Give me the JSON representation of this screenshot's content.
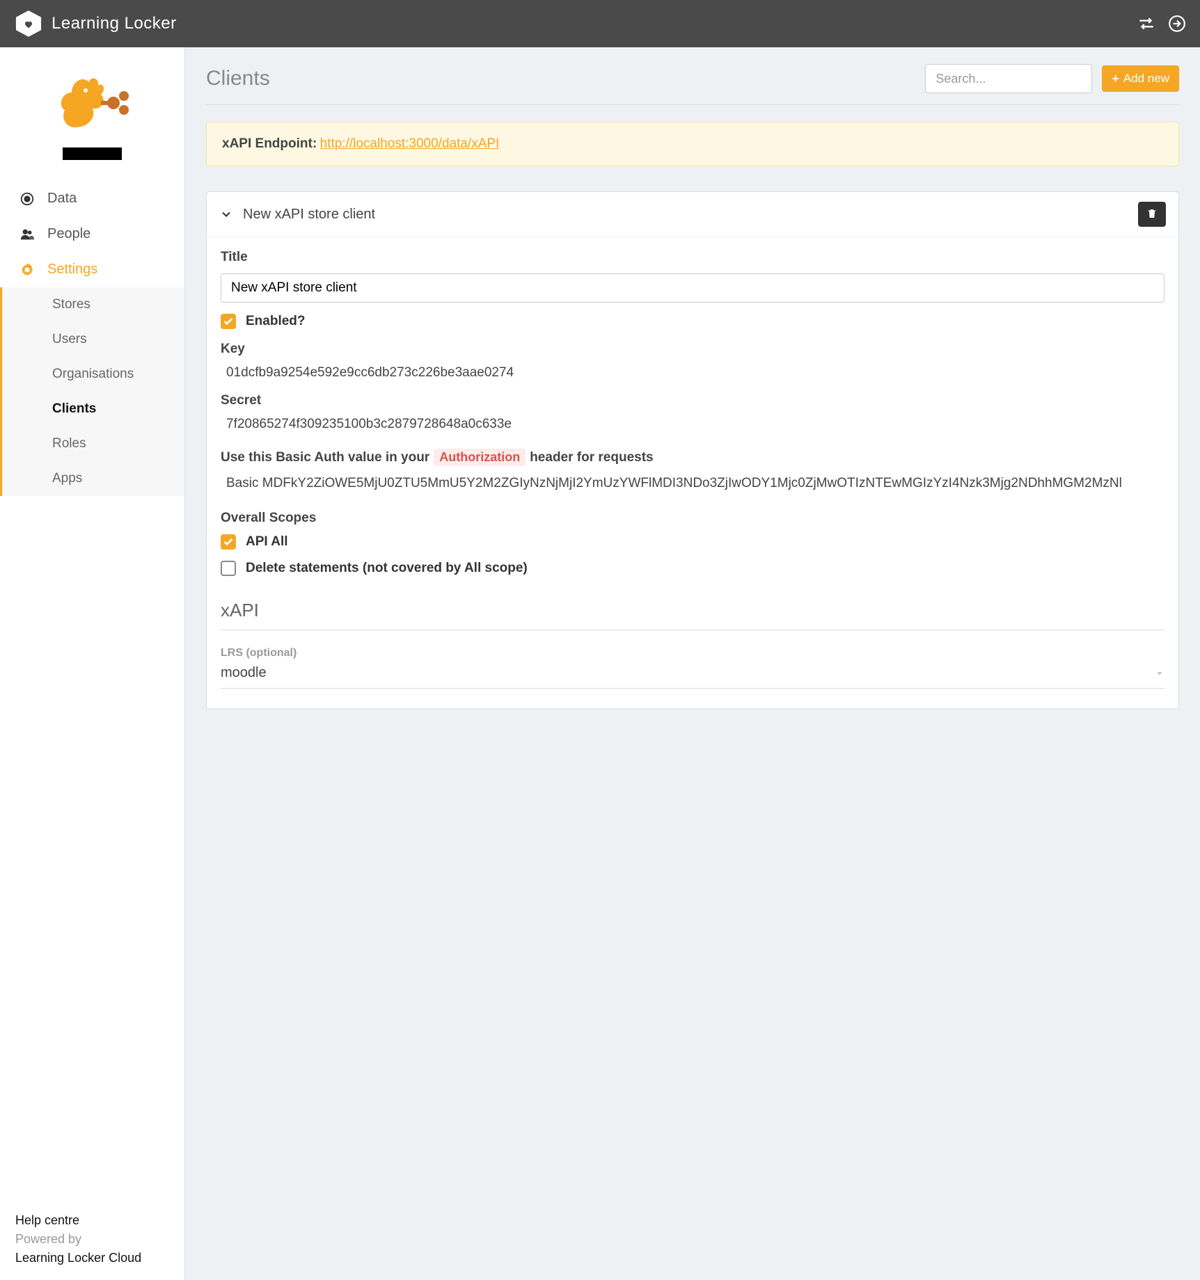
{
  "header": {
    "brand": "Learning Locker"
  },
  "sidebar": {
    "nav": {
      "data": "Data",
      "people": "People",
      "settings": "Settings"
    },
    "subnav": {
      "stores": "Stores",
      "users": "Users",
      "organisations": "Organisations",
      "clients": "Clients",
      "roles": "Roles",
      "apps": "Apps"
    },
    "footer": {
      "help": "Help centre",
      "powered": "Powered by",
      "cloud": "Learning Locker Cloud"
    }
  },
  "page": {
    "title": "Clients",
    "search_placeholder": "Search...",
    "add_label": "Add new"
  },
  "endpoint": {
    "label": "xAPI Endpoint:",
    "url": "http://localhost:3000/data/xAPI"
  },
  "client": {
    "header_title": "New xAPI store client",
    "title_label": "Title",
    "title_value": "New xAPI store client",
    "enabled_label": "Enabled?",
    "enabled": true,
    "key_label": "Key",
    "key_value": "01dcfb9a9254e592e9cc6db273c226be3aae0274",
    "secret_label": "Secret",
    "secret_value": "7f20865274f309235100b3c2879728648a0c633e",
    "auth_prefix": "Use this Basic Auth value in your",
    "auth_code": "Authorization",
    "auth_suffix": "header for requests",
    "basic_auth": "Basic MDFkY2ZiOWE5MjU0ZTU5MmU5Y2M2ZGIyNzNjMjI2YmUzYWFlMDI3NDo3ZjIwODY1Mjc0ZjMwOTIzNTEwMGIzYzI4Nzk3Mjg2NDhhMGM2MzNl",
    "scopes_label": "Overall Scopes",
    "scope_all": "API All",
    "scope_all_checked": true,
    "scope_delete": "Delete statements (not covered by All scope)",
    "scope_delete_checked": false,
    "xapi_section": "xAPI",
    "lrs_label": "LRS (optional)",
    "lrs_value": "moodle"
  }
}
